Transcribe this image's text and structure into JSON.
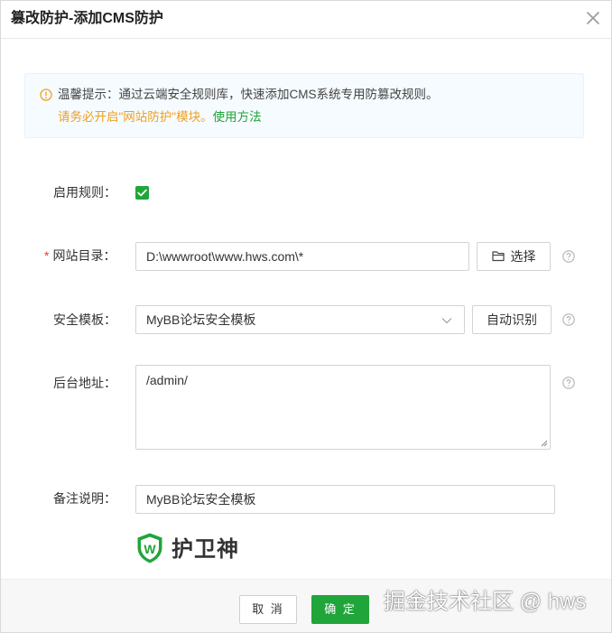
{
  "dialog": {
    "title": "篡改防护-添加CMS防护"
  },
  "notice": {
    "text": "温馨提示：通过云端安全规则库，快速添加CMS系统专用防篡改规则。",
    "warning": "请务必开启\"网站防护\"模块。",
    "link": "使用方法"
  },
  "form": {
    "enable": {
      "label": "启用规则：",
      "checked": true
    },
    "site_dir": {
      "required_mark": "*",
      "label": "网站目录：",
      "value": "D:\\wwwroot\\www.hws.com\\*",
      "button": "选择"
    },
    "template": {
      "label": "安全模板：",
      "value": "MyBB论坛安全模板",
      "button": "自动识别"
    },
    "admin_url": {
      "label": "后台地址：",
      "value": "/admin/"
    },
    "remark": {
      "label": "备注说明：",
      "value": "MyBB论坛安全模板"
    }
  },
  "brand": {
    "name": "护卫神",
    "letter": "W"
  },
  "footer": {
    "cancel": "取 消",
    "ok": "确 定"
  },
  "watermark": "掘金技术社区 @ hws",
  "colors": {
    "accent": "#20a53a",
    "warning": "#f0a020",
    "required": "#e23c3c"
  }
}
